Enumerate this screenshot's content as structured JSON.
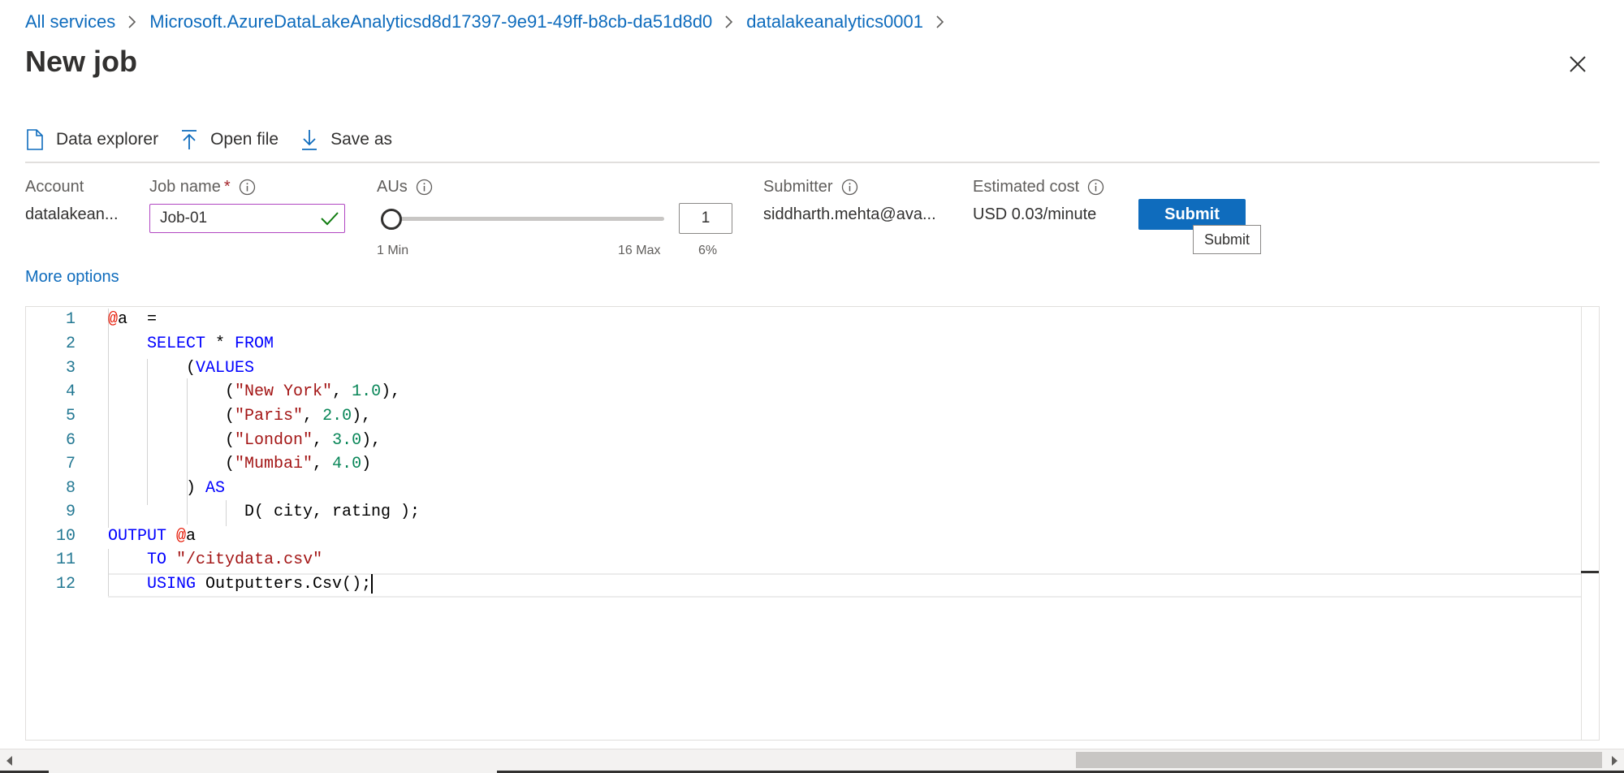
{
  "breadcrumb": {
    "items": [
      "All services",
      "Microsoft.AzureDataLakeAnalyticsd8d17397-9e91-49ff-b8cb-da51d8d0",
      "datalakeanalytics0001"
    ]
  },
  "page": {
    "title": "New job"
  },
  "toolbar": {
    "data_explorer": "Data explorer",
    "open_file": "Open file",
    "save_as": "Save as"
  },
  "form": {
    "account_label": "Account",
    "account_value": "datalakean...",
    "jobname_label": "Job name",
    "jobname_required": "*",
    "jobname_value": "Job-01",
    "aus_label": "AUs",
    "aus_min": "1 Min",
    "aus_max": "16 Max",
    "aus_percent": "6%",
    "aus_value": "1",
    "aus_slider_fraction": 0.0,
    "submitter_label": "Submitter",
    "submitter_value": "siddharth.mehta@ava...",
    "cost_label": "Estimated cost",
    "cost_value": "USD 0.03/minute",
    "submit_label": "Submit",
    "submit_tooltip": "Submit",
    "more_options": "More options"
  },
  "editor": {
    "line_numbers": [
      "1",
      "2",
      "3",
      "4",
      "5",
      "6",
      "7",
      "8",
      "9",
      "10",
      "11",
      "12"
    ]
  },
  "colors": {
    "accent": "#0f6cbd",
    "input_focus_border": "#b146c2",
    "valid_check": "#107c10"
  }
}
